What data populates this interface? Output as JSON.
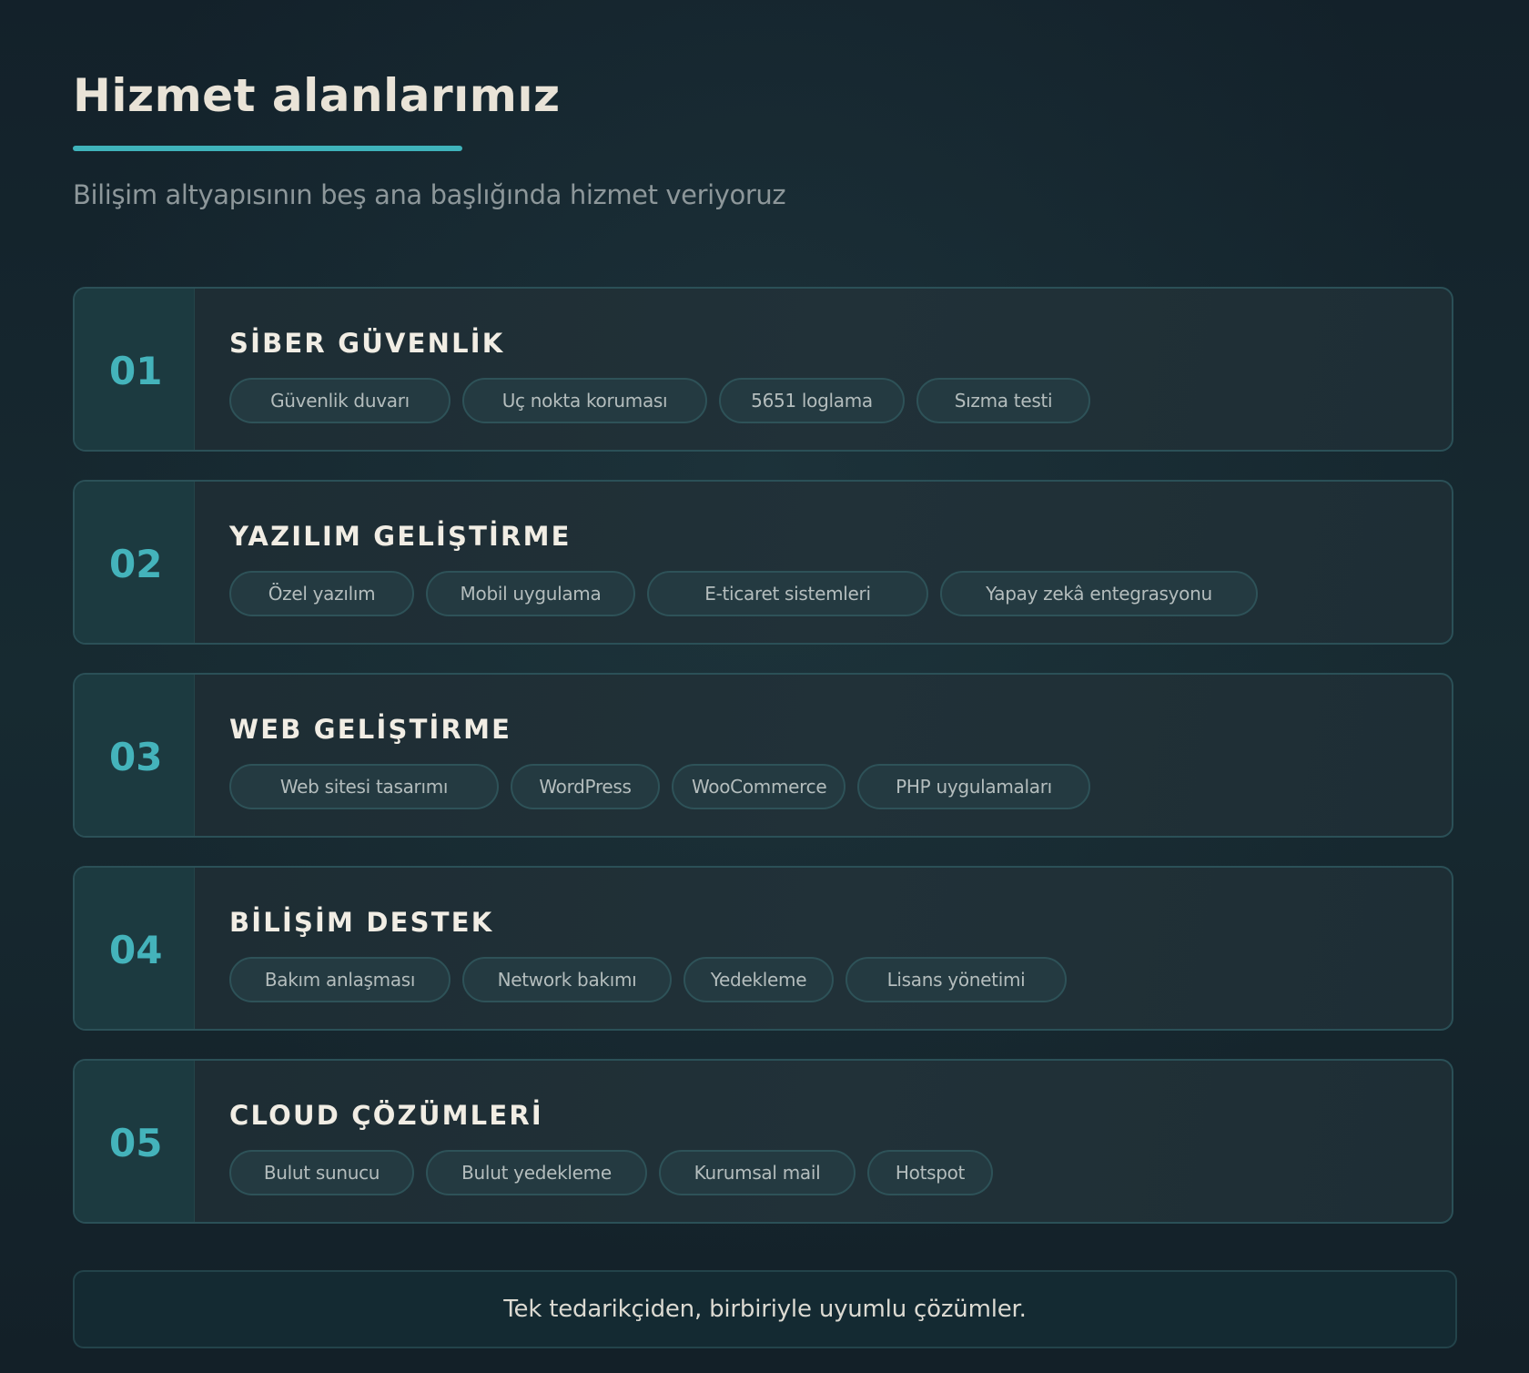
{
  "header": {
    "title": "Hizmet alanlarımız",
    "subtitle": "Bilişim altyapısının beş ana başlığında hizmet veriyoruz"
  },
  "services": [
    {
      "number": "01",
      "title": "SİBER GÜVENLİK",
      "tags": [
        "Güvenlik duvarı",
        "Uç nokta koruması",
        "5651 loglama",
        "Sızma testi"
      ]
    },
    {
      "number": "02",
      "title": "YAZILIM GELİŞTİRME",
      "tags": [
        "Özel yazılım",
        "Mobil uygulama",
        "E-ticaret sistemleri",
        "Yapay zekâ entegrasyonu"
      ]
    },
    {
      "number": "03",
      "title": "WEB GELİŞTİRME",
      "tags": [
        "Web sitesi tasarımı",
        "WordPress",
        "WooCommerce",
        "PHP uygulamaları"
      ]
    },
    {
      "number": "04",
      "title": "BİLİŞİM DESTEK",
      "tags": [
        "Bakım anlaşması",
        "Network bakımı",
        "Yedekleme",
        "Lisans yönetimi"
      ]
    },
    {
      "number": "05",
      "title": "CLOUD ÇÖZÜMLERİ",
      "tags": [
        "Bulut sunucu",
        "Bulut yedekleme",
        "Kurumsal mail",
        "Hotspot"
      ]
    }
  ],
  "footer": {
    "text": "Tek tedarikçiden, birbiriyle uyumlu çözümler."
  },
  "colors": {
    "accent": "#3fb3bb",
    "background": "#142129",
    "card_background": "#213138",
    "number_column": "#1c3a40"
  }
}
